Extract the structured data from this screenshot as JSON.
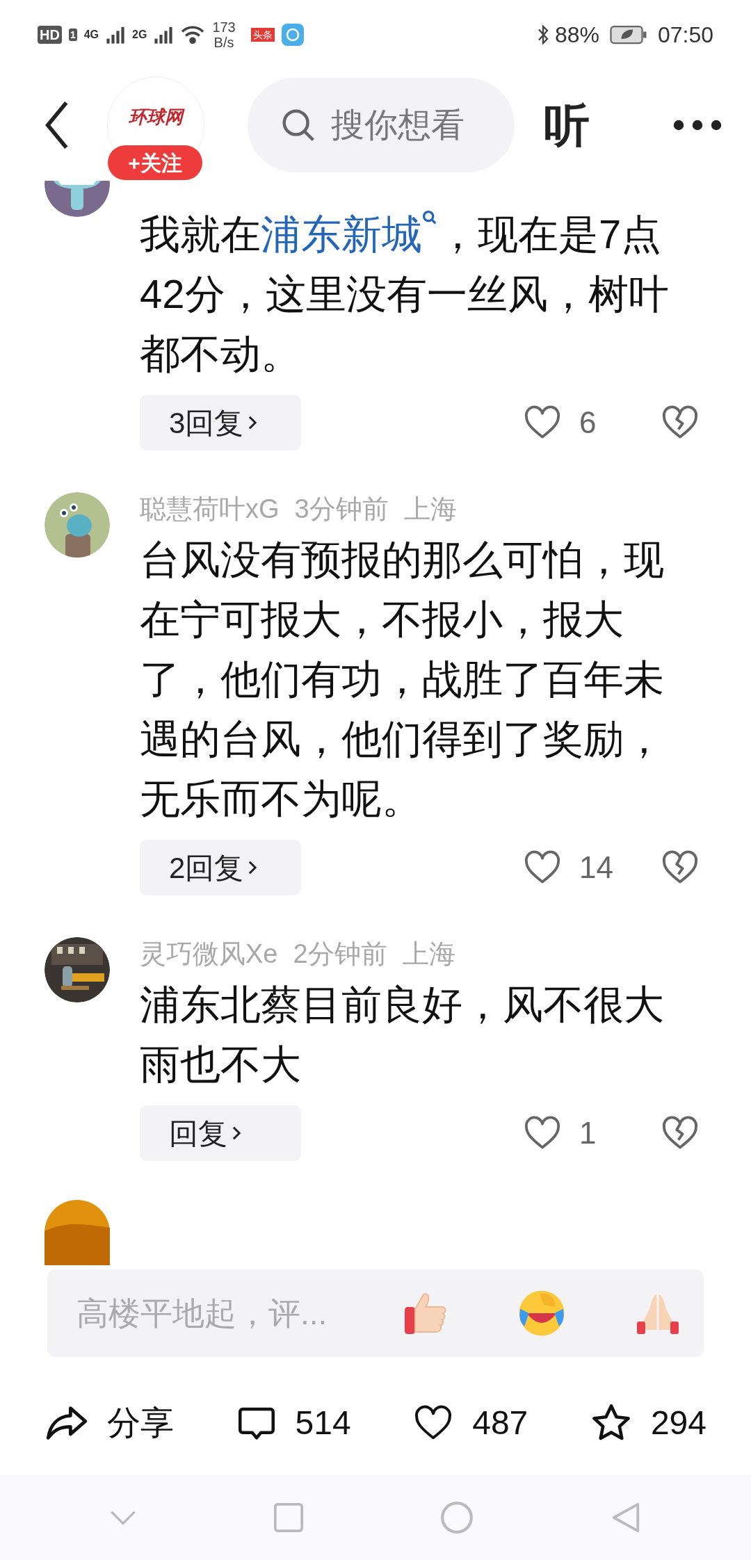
{
  "status_bar": {
    "network_labels": [
      "HD",
      "1",
      "4G",
      "2G"
    ],
    "speed": [
      "173",
      "B/s"
    ],
    "app_badge": "头条",
    "battery": "88%",
    "time": "07:50"
  },
  "header": {
    "logo": "环球网",
    "follow": "+关注",
    "search_placeholder": "搜你想看",
    "listen": "听"
  },
  "comments": [
    {
      "kind": "monster",
      "body": [
        {
          "kind": "plain",
          "text": "我就在"
        },
        {
          "kind": "link",
          "text": "浦东新城"
        },
        {
          "kind": "plain",
          "text": "，现在是7点42分，这里没有一丝风，树叶都不动。"
        }
      ],
      "replies": "3回复",
      "likes": "6"
    },
    {
      "meta": [
        "聪慧荷叶xG",
        "3分钟前",
        "上海"
      ],
      "kind": "plant",
      "body": [
        {
          "kind": "plain",
          "text": "台风没有预报的那么可怕，现在宁可报大，不报小，报大了，他们有功，战胜了百年未遇的台风，他们得到了奖励，无乐而不为呢。"
        }
      ],
      "replies": "2回复",
      "likes": "14"
    },
    {
      "meta": [
        "灵巧微风Xe",
        "2分钟前",
        "上海"
      ],
      "kind": "picture",
      "body": [
        {
          "kind": "plain",
          "text": "浦东北蔡目前良好，风不很大雨也不大"
        }
      ],
      "replies": "回复",
      "likes": "1"
    }
  ],
  "composer": {
    "placeholder": "高楼平地起，评..."
  },
  "actions": [
    {
      "kind": "share",
      "label": "分享"
    },
    {
      "kind": "comment",
      "label": "514"
    },
    {
      "kind": "like",
      "label": "487"
    },
    {
      "kind": "star",
      "label": "294"
    }
  ]
}
